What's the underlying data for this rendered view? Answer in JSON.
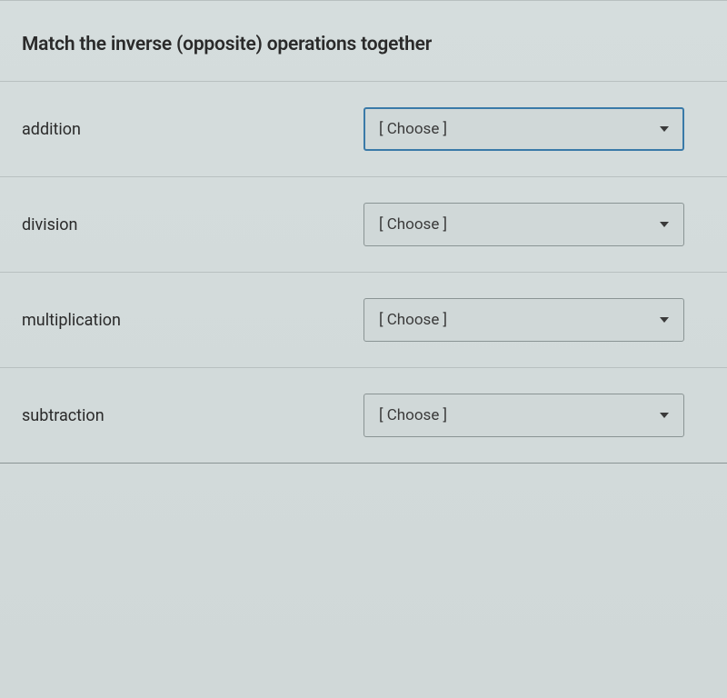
{
  "question": {
    "title": "Match the inverse (opposite) operations together"
  },
  "rows": [
    {
      "label": "addition",
      "placeholder": "[ Choose ]",
      "focused": true
    },
    {
      "label": "division",
      "placeholder": "[ Choose ]",
      "focused": false
    },
    {
      "label": "multiplication",
      "placeholder": "[ Choose ]",
      "focused": false
    },
    {
      "label": "subtraction",
      "placeholder": "[ Choose ]",
      "focused": false
    }
  ]
}
